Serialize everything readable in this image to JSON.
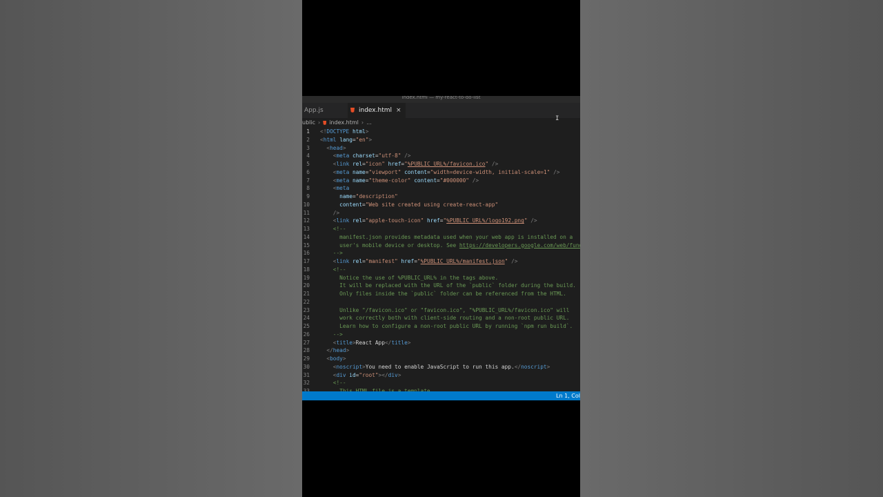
{
  "window": {
    "title": "index.html — my-react-to-do-list"
  },
  "tabs": [
    {
      "label": "App.js",
      "icon": "js-file-icon"
    },
    {
      "label": "index.html",
      "icon": "html-file-icon",
      "close": "×"
    }
  ],
  "breadcrumb": {
    "folder": "ublic",
    "file": "index.html",
    "more": "..."
  },
  "status": {
    "position": "Ln 1, Col"
  },
  "colors": {
    "accent": "#007acc",
    "tag": "#569cd6",
    "attr": "#9cdcfe",
    "string": "#ce9178",
    "comment": "#6a9955",
    "html_icon": "#e44d26"
  },
  "code": {
    "lines": [
      {
        "n": "1",
        "segs": [
          [
            "pn",
            "<!"
          ],
          [
            "tg",
            "DOCTYPE"
          ],
          [
            "tx",
            " "
          ],
          [
            "at",
            "html"
          ],
          [
            "pn",
            ">"
          ]
        ]
      },
      {
        "n": "2",
        "segs": [
          [
            "pn",
            "<"
          ],
          [
            "tg",
            "html"
          ],
          [
            "tx",
            " "
          ],
          [
            "at",
            "lang"
          ],
          [
            "tx",
            "="
          ],
          [
            "st",
            "\"en\""
          ],
          [
            "pn",
            ">"
          ]
        ]
      },
      {
        "n": "3",
        "segs": [
          [
            "tx",
            "  "
          ],
          [
            "pn",
            "<"
          ],
          [
            "tg",
            "head"
          ],
          [
            "pn",
            ">"
          ]
        ]
      },
      {
        "n": "4",
        "segs": [
          [
            "tx",
            "    "
          ],
          [
            "pn",
            "<"
          ],
          [
            "tg",
            "meta"
          ],
          [
            "tx",
            " "
          ],
          [
            "at",
            "charset"
          ],
          [
            "tx",
            "="
          ],
          [
            "st",
            "\"utf-8\""
          ],
          [
            "tx",
            " "
          ],
          [
            "pn",
            "/>"
          ]
        ]
      },
      {
        "n": "5",
        "segs": [
          [
            "tx",
            "    "
          ],
          [
            "pn",
            "<"
          ],
          [
            "tg",
            "link"
          ],
          [
            "tx",
            " "
          ],
          [
            "at",
            "rel"
          ],
          [
            "tx",
            "="
          ],
          [
            "st",
            "\"icon\""
          ],
          [
            "tx",
            " "
          ],
          [
            "at",
            "href"
          ],
          [
            "tx",
            "="
          ],
          [
            "st",
            "\""
          ],
          [
            "stu",
            "%PUBLIC_URL%/favicon.ico"
          ],
          [
            "st",
            "\""
          ],
          [
            "tx",
            " "
          ],
          [
            "pn",
            "/>"
          ]
        ]
      },
      {
        "n": "6",
        "segs": [
          [
            "tx",
            "    "
          ],
          [
            "pn",
            "<"
          ],
          [
            "tg",
            "meta"
          ],
          [
            "tx",
            " "
          ],
          [
            "at",
            "name"
          ],
          [
            "tx",
            "="
          ],
          [
            "st",
            "\"viewport\""
          ],
          [
            "tx",
            " "
          ],
          [
            "at",
            "content"
          ],
          [
            "tx",
            "="
          ],
          [
            "st",
            "\"width=device-width, initial-scale=1\""
          ],
          [
            "tx",
            " "
          ],
          [
            "pn",
            "/>"
          ]
        ]
      },
      {
        "n": "7",
        "segs": [
          [
            "tx",
            "    "
          ],
          [
            "pn",
            "<"
          ],
          [
            "tg",
            "meta"
          ],
          [
            "tx",
            " "
          ],
          [
            "at",
            "name"
          ],
          [
            "tx",
            "="
          ],
          [
            "st",
            "\"theme-color\""
          ],
          [
            "tx",
            " "
          ],
          [
            "at",
            "content"
          ],
          [
            "tx",
            "="
          ],
          [
            "st",
            "\"#000000\""
          ],
          [
            "tx",
            " "
          ],
          [
            "pn",
            "/>"
          ]
        ]
      },
      {
        "n": "8",
        "segs": [
          [
            "tx",
            "    "
          ],
          [
            "pn",
            "<"
          ],
          [
            "tg",
            "meta"
          ]
        ]
      },
      {
        "n": "9",
        "segs": [
          [
            "tx",
            "      "
          ],
          [
            "at",
            "name"
          ],
          [
            "tx",
            "="
          ],
          [
            "st",
            "\"description\""
          ]
        ]
      },
      {
        "n": "10",
        "segs": [
          [
            "tx",
            "      "
          ],
          [
            "at",
            "content"
          ],
          [
            "tx",
            "="
          ],
          [
            "st",
            "\"Web site created using create-react-app\""
          ]
        ]
      },
      {
        "n": "11",
        "segs": [
          [
            "tx",
            "    "
          ],
          [
            "pn",
            "/>"
          ]
        ]
      },
      {
        "n": "12",
        "segs": [
          [
            "tx",
            "    "
          ],
          [
            "pn",
            "<"
          ],
          [
            "tg",
            "link"
          ],
          [
            "tx",
            " "
          ],
          [
            "at",
            "rel"
          ],
          [
            "tx",
            "="
          ],
          [
            "st",
            "\"apple-touch-icon\""
          ],
          [
            "tx",
            " "
          ],
          [
            "at",
            "href"
          ],
          [
            "tx",
            "="
          ],
          [
            "st",
            "\""
          ],
          [
            "stu",
            "%PUBLIC_URL%/logo192.png"
          ],
          [
            "st",
            "\""
          ],
          [
            "tx",
            " "
          ],
          [
            "pn",
            "/>"
          ]
        ]
      },
      {
        "n": "13",
        "segs": [
          [
            "tx",
            "    "
          ],
          [
            "cm",
            "<!--"
          ]
        ]
      },
      {
        "n": "14",
        "segs": [
          [
            "tx",
            "      "
          ],
          [
            "cm",
            "manifest.json provides metadata used when your web app is installed on a"
          ]
        ]
      },
      {
        "n": "15",
        "segs": [
          [
            "tx",
            "      "
          ],
          [
            "cm",
            "user's mobile device or desktop. See "
          ],
          [
            "lk",
            "https://developers.google.com/web/fundamentals/web-app-manifest/"
          ]
        ]
      },
      {
        "n": "16",
        "segs": [
          [
            "tx",
            "    "
          ],
          [
            "cm",
            "-->"
          ]
        ]
      },
      {
        "n": "17",
        "segs": [
          [
            "tx",
            "    "
          ],
          [
            "pn",
            "<"
          ],
          [
            "tg",
            "link"
          ],
          [
            "tx",
            " "
          ],
          [
            "at",
            "rel"
          ],
          [
            "tx",
            "="
          ],
          [
            "st",
            "\"manifest\""
          ],
          [
            "tx",
            " "
          ],
          [
            "at",
            "href"
          ],
          [
            "tx",
            "="
          ],
          [
            "st",
            "\""
          ],
          [
            "stu",
            "%PUBLIC_URL%/manifest.json"
          ],
          [
            "st",
            "\""
          ],
          [
            "tx",
            " "
          ],
          [
            "pn",
            "/>"
          ]
        ]
      },
      {
        "n": "18",
        "segs": [
          [
            "tx",
            "    "
          ],
          [
            "cm",
            "<!--"
          ]
        ]
      },
      {
        "n": "19",
        "segs": [
          [
            "tx",
            "      "
          ],
          [
            "cm",
            "Notice the use of %PUBLIC_URL% in the tags above."
          ]
        ]
      },
      {
        "n": "20",
        "segs": [
          [
            "tx",
            "      "
          ],
          [
            "cm",
            "It will be replaced with the URL of the `public` folder during the build."
          ]
        ]
      },
      {
        "n": "21",
        "segs": [
          [
            "tx",
            "      "
          ],
          [
            "cm",
            "Only files inside the `public` folder can be referenced from the HTML."
          ]
        ]
      },
      {
        "n": "22",
        "segs": []
      },
      {
        "n": "23",
        "segs": [
          [
            "tx",
            "      "
          ],
          [
            "cm",
            "Unlike \"/favicon.ico\" or \"favicon.ico\", \"%PUBLIC_URL%/favicon.ico\" will"
          ]
        ]
      },
      {
        "n": "24",
        "segs": [
          [
            "tx",
            "      "
          ],
          [
            "cm",
            "work correctly both with client-side routing and a non-root public URL."
          ]
        ]
      },
      {
        "n": "25",
        "segs": [
          [
            "tx",
            "      "
          ],
          [
            "cm",
            "Learn how to configure a non-root public URL by running `npm run build`."
          ]
        ]
      },
      {
        "n": "26",
        "segs": [
          [
            "tx",
            "    "
          ],
          [
            "cm",
            "-->"
          ]
        ]
      },
      {
        "n": "27",
        "segs": [
          [
            "tx",
            "    "
          ],
          [
            "pn",
            "<"
          ],
          [
            "tg",
            "title"
          ],
          [
            "pn",
            ">"
          ],
          [
            "tx",
            "React App"
          ],
          [
            "pn",
            "</"
          ],
          [
            "tg",
            "title"
          ],
          [
            "pn",
            ">"
          ]
        ]
      },
      {
        "n": "28",
        "segs": [
          [
            "tx",
            "  "
          ],
          [
            "pn",
            "</"
          ],
          [
            "tg",
            "head"
          ],
          [
            "pn",
            ">"
          ]
        ]
      },
      {
        "n": "29",
        "segs": [
          [
            "tx",
            "  "
          ],
          [
            "pn",
            "<"
          ],
          [
            "tg",
            "body"
          ],
          [
            "pn",
            ">"
          ]
        ]
      },
      {
        "n": "30",
        "segs": [
          [
            "tx",
            "    "
          ],
          [
            "pn",
            "<"
          ],
          [
            "tg",
            "noscript"
          ],
          [
            "pn",
            ">"
          ],
          [
            "tx",
            "You need to enable JavaScript to run this app."
          ],
          [
            "pn",
            "</"
          ],
          [
            "tg",
            "noscript"
          ],
          [
            "pn",
            ">"
          ]
        ]
      },
      {
        "n": "31",
        "segs": [
          [
            "tx",
            "    "
          ],
          [
            "pn",
            "<"
          ],
          [
            "tg",
            "div"
          ],
          [
            "tx",
            " "
          ],
          [
            "at",
            "id"
          ],
          [
            "tx",
            "="
          ],
          [
            "st",
            "\"root\""
          ],
          [
            "pn",
            "></"
          ],
          [
            "tg",
            "div"
          ],
          [
            "pn",
            ">"
          ]
        ]
      },
      {
        "n": "32",
        "segs": [
          [
            "tx",
            "    "
          ],
          [
            "cm",
            "<!--"
          ]
        ]
      },
      {
        "n": "33",
        "segs": [
          [
            "tx",
            "      "
          ],
          [
            "cm",
            "This HTML file is a template."
          ]
        ]
      }
    ]
  }
}
